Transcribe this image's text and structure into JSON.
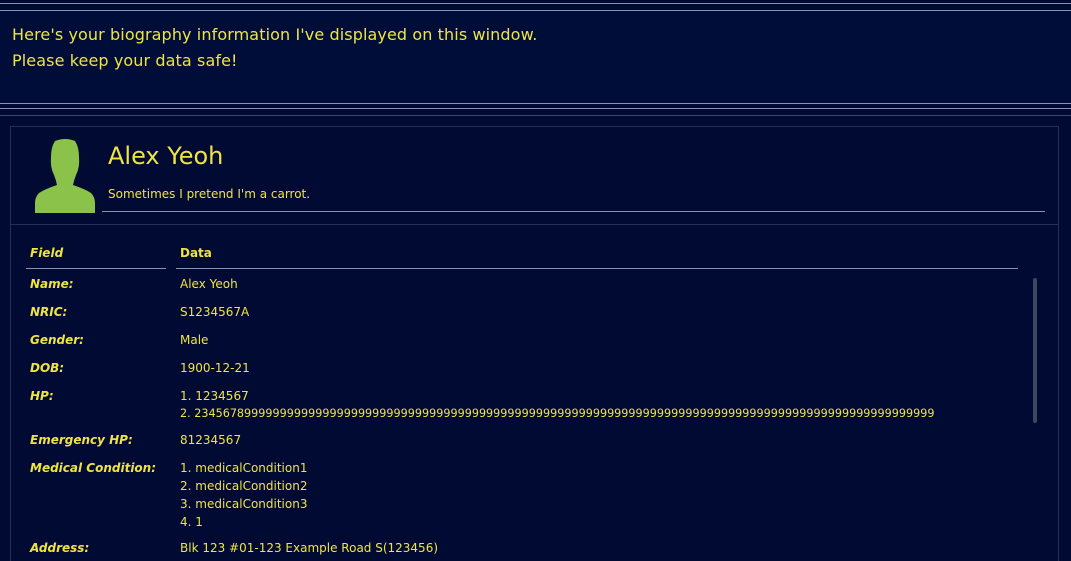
{
  "message": {
    "line1": "Here's your biography information I've displayed on this window.",
    "line2": "Please keep your data safe!"
  },
  "profile": {
    "name": "Alex Yeoh",
    "quote": "Sometimes I pretend I'm a carrot.",
    "avatar_icon": "person-silhouette-icon",
    "avatar_color": "#8bc34a"
  },
  "table": {
    "headers": {
      "field": "Field",
      "data": "Data"
    },
    "rows": [
      {
        "label": "Name:",
        "values": [
          "Alex Yeoh"
        ]
      },
      {
        "label": "NRIC:",
        "values": [
          "S1234567A"
        ]
      },
      {
        "label": "Gender:",
        "values": [
          "Male"
        ]
      },
      {
        "label": "DOB:",
        "values": [
          "1900-12-21"
        ]
      },
      {
        "label": "HP:",
        "values": [
          "1. 1234567",
          "2. 23456789999999999999999999999999999999999999999999999999999999999999999999999999999999999999999999999999"
        ]
      },
      {
        "label": "Emergency HP:",
        "values": [
          "81234567"
        ]
      },
      {
        "label": "Medical Condition:",
        "values": [
          "1. medicalCondition1",
          "2. medicalCondition2",
          "3. medicalCondition3",
          "4. 1"
        ]
      },
      {
        "label": "Address:",
        "values": [
          "Blk 123 #01-123 Example Road S(123456)"
        ]
      }
    ]
  },
  "colors": {
    "background": "#000a33",
    "text": "#f0e442",
    "divider": "#8a93ad"
  }
}
